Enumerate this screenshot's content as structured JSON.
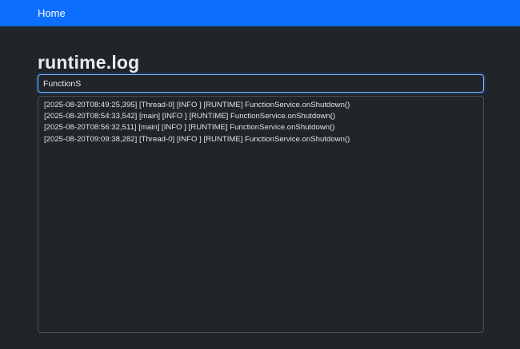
{
  "navbar": {
    "home_label": "Home",
    "background_color": "#0d6efd"
  },
  "page": {
    "title": "runtime.log"
  },
  "search": {
    "value": "FunctionS",
    "focus_color": "#86b7fe"
  },
  "log": {
    "lines": [
      "[2025-08-20T08:49:25,395] [Thread-0] [INFO ] [RUNTIME] FunctionService.onShutdown()",
      "[2025-08-20T08:54:33,542] [main] [INFO ] [RUNTIME] FunctionService.onShutdown()",
      "[2025-08-20T08:56:32,511] [main] [INFO ] [RUNTIME] FunctionService.onShutdown()",
      "[2025-08-20T09:09:38,282] [Thread-0] [INFO ] [RUNTIME] FunctionService.onShutdown()"
    ]
  },
  "theme": {
    "background": "#212529",
    "text": "#dee2e6"
  }
}
